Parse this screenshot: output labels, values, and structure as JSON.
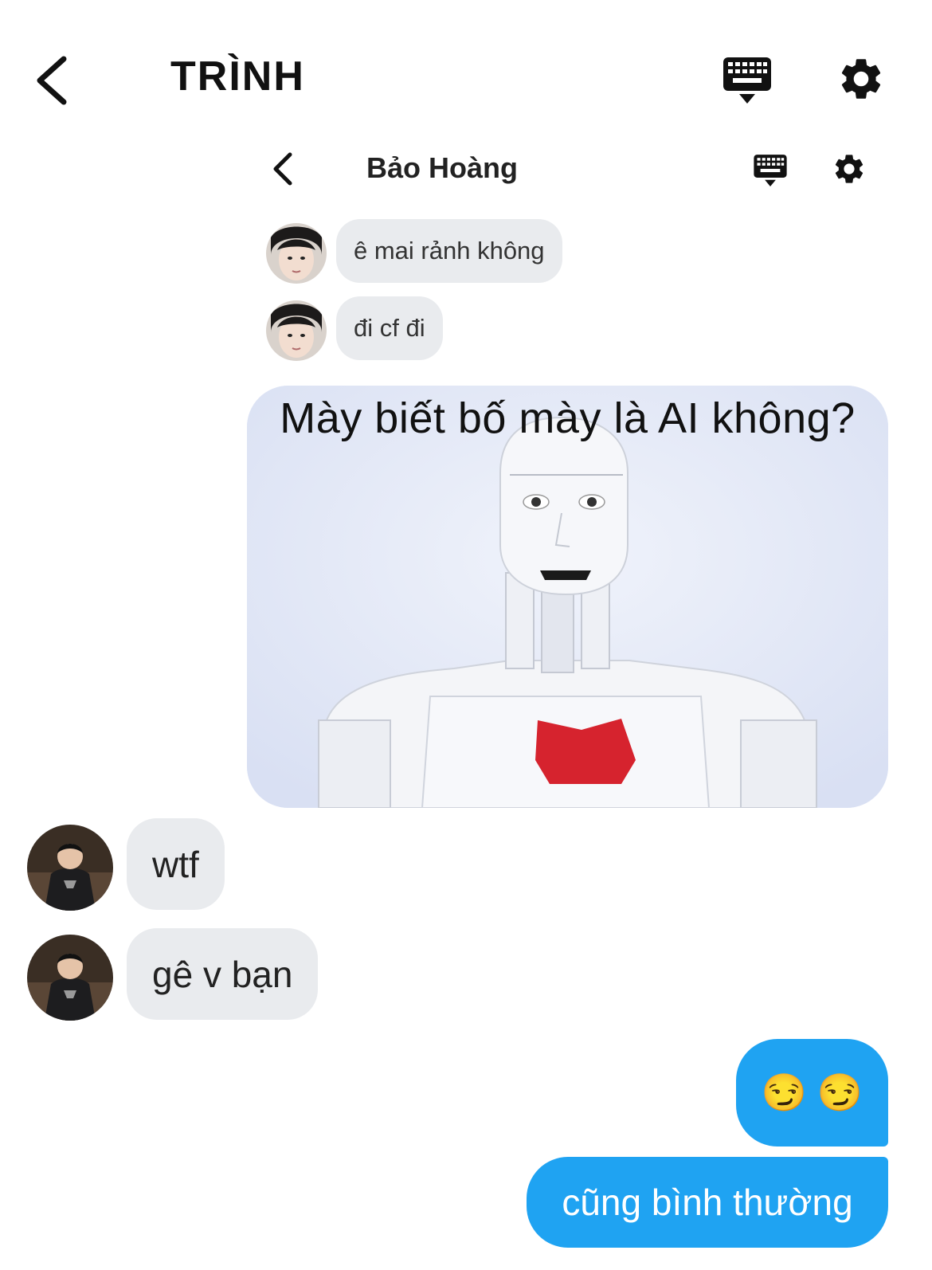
{
  "header": {
    "title": "TRÌNH"
  },
  "inner_header": {
    "title": "Bảo Hoàng"
  },
  "messages": {
    "inner_1": "ê mai rảnh không",
    "inner_2": "đi cf đi",
    "meme_caption": "Mày biết bố mày là AI không?",
    "reply_1": "wtf",
    "reply_2": "gê v bạn",
    "sent_emoji": "😏 😏",
    "sent_text": "cũng bình thường"
  },
  "icons": {
    "back": "chevron-left-icon",
    "keyboard": "keyboard-icon",
    "settings": "gear-icon"
  },
  "colors": {
    "incoming_bubble": "#e9ebee",
    "outgoing_bubble": "#1fa3f2",
    "meme_background": "#e4e9f8"
  }
}
